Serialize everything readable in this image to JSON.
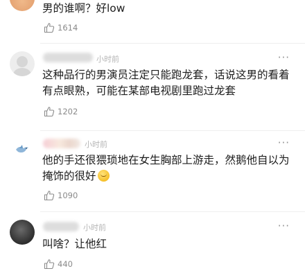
{
  "comments": [
    {
      "text": "男的谁啊？好low",
      "likes": "1614"
    },
    {
      "time": "小时前",
      "text": "这种品行的男演员注定只能跑龙套，话说这男的看着有点眼熟，可能在某部电视剧里跑过龙套",
      "likes": "1202",
      "more": "···"
    },
    {
      "time": "小时前",
      "text": "他的手还很猥琐地在女生胸部上游走，然鹅他自以为掩饰的很好",
      "likes": "1090",
      "more": "···"
    },
    {
      "time": "小时前",
      "text": "叫啥？让他红",
      "likes": "440",
      "more": "···"
    }
  ],
  "icons": {
    "like": "thumbs-up-outline-icon",
    "emoji": "smiling-face-emoji",
    "avatar_badge": "bird-icon"
  },
  "colors": {
    "text": "#1c1c1c",
    "meta": "#8a8a8a",
    "time": "#b5b5b5"
  }
}
